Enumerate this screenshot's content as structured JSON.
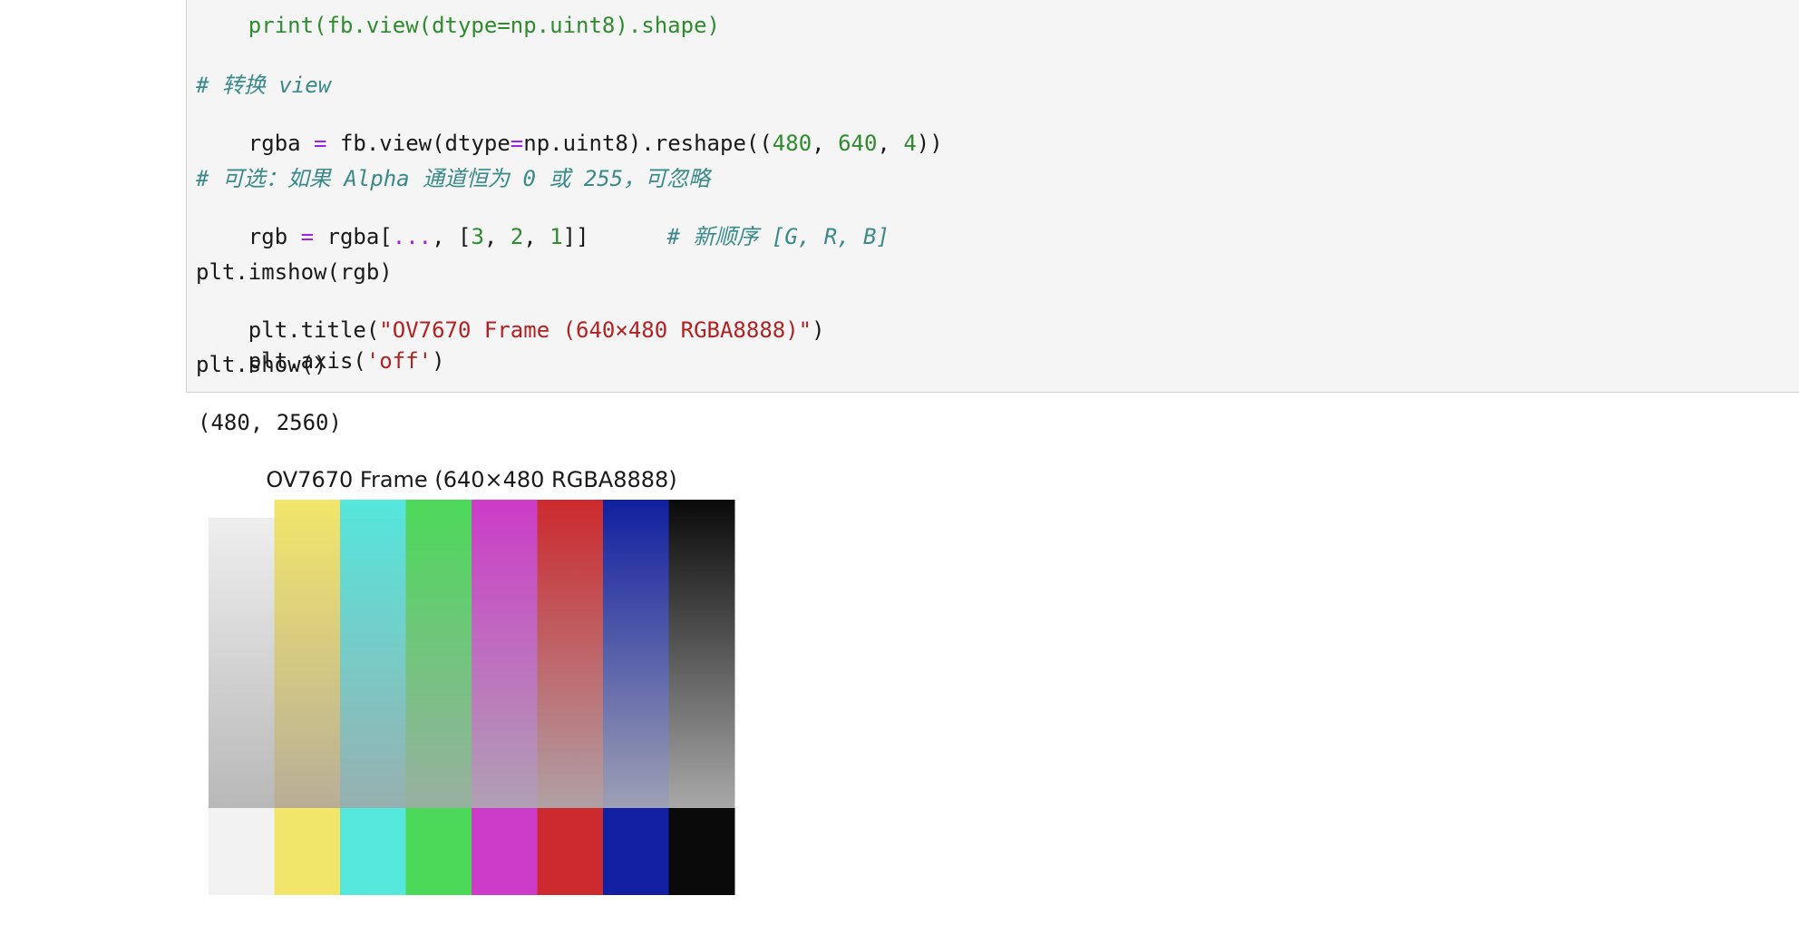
{
  "code": {
    "line1": {
      "parts": [
        "print(fb.view(dtype=np.uint8).shape)"
      ]
    },
    "comment_view": "# 转换 view",
    "reshape": {
      "a": "rgba ",
      "eq": "=",
      "b": " fb.view(dtype",
      "eq2": "=",
      "c": "np.uint8).reshape((",
      "n1": "480",
      "s1": ", ",
      "n2": "640",
      "s2": ", ",
      "n3": "4",
      "d": "))"
    },
    "comment_optional": "# 可选：如果 Alpha 通道恒为 0 或 255，可忽略",
    "rgb_line": {
      "a": "rgb ",
      "eq": "=",
      "b": " rgba[",
      "ell": "...",
      "c": ", [",
      "n1": "3",
      "s1": ", ",
      "n2": "2",
      "s2": ", ",
      "n3": "1",
      "d": "]]",
      "comment": "# 新顺序 [G, R, B]"
    },
    "imshow": "plt.imshow(rgb)",
    "title_line": {
      "a": "plt.title(",
      "s": "\"OV7670 Frame (640×480 RGBA8888)\"",
      "b": ")"
    },
    "axis_line": {
      "a": "plt.axis(",
      "s": "'off'",
      "b": ")"
    },
    "show": "plt.show()"
  },
  "output": {
    "shape": "(480, 2560)",
    "figure_title": "OV7670 Frame (640×480 RGBA8888)"
  },
  "colors": {
    "cell_bg": "#f5f5f5",
    "comment": "#3a8a8a",
    "number": "#2e8b2e",
    "operator": "#a020f0",
    "string": "#b22222",
    "bars": [
      "#f2f2f2",
      "#f2e66a",
      "#55e6dc",
      "#4cd95a",
      "#cc3cc8",
      "#cc2a2e",
      "#1020a0",
      "#0a0a0a"
    ],
    "faded": [
      "#b8b8b8",
      "#b8ae98",
      "#98b0b0",
      "#98b0a0",
      "#b0a0b4",
      "#b0a0a4",
      "#9ea0b4",
      "#a8a8a8"
    ]
  }
}
